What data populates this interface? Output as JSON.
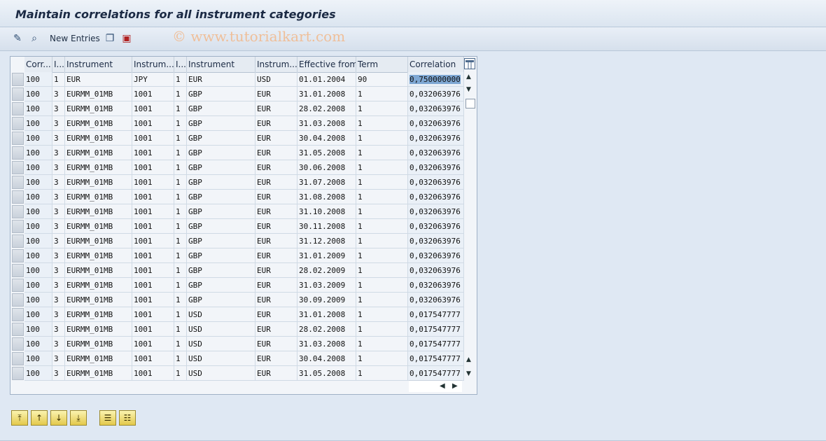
{
  "header": {
    "title": "Maintain correlations for all instrument categories"
  },
  "toolbar": {
    "new_entries_label": "New Entries",
    "icons": [
      "change-display-icon",
      "find-icon",
      "copy-icon",
      "delete-icon"
    ]
  },
  "watermark": "© www.tutorialkart.com",
  "table": {
    "columns": [
      "Corr...",
      "I...",
      "Instrument",
      "Instrum...",
      "I...",
      "Instrument",
      "Instrum...",
      "Effective from",
      "Term",
      "Correlation"
    ],
    "rows": [
      [
        "100",
        "1",
        "EUR",
        "JPY",
        "1",
        "EUR",
        "USD",
        "01.01.2004",
        "90",
        "0,750000000"
      ],
      [
        "100",
        "3",
        "EURMM_01MB",
        "1001",
        "1",
        "GBP",
        "EUR",
        "31.01.2008",
        "1",
        "0,032063976"
      ],
      [
        "100",
        "3",
        "EURMM_01MB",
        "1001",
        "1",
        "GBP",
        "EUR",
        "28.02.2008",
        "1",
        "0,032063976"
      ],
      [
        "100",
        "3",
        "EURMM_01MB",
        "1001",
        "1",
        "GBP",
        "EUR",
        "31.03.2008",
        "1",
        "0,032063976"
      ],
      [
        "100",
        "3",
        "EURMM_01MB",
        "1001",
        "1",
        "GBP",
        "EUR",
        "30.04.2008",
        "1",
        "0,032063976"
      ],
      [
        "100",
        "3",
        "EURMM_01MB",
        "1001",
        "1",
        "GBP",
        "EUR",
        "31.05.2008",
        "1",
        "0,032063976"
      ],
      [
        "100",
        "3",
        "EURMM_01MB",
        "1001",
        "1",
        "GBP",
        "EUR",
        "30.06.2008",
        "1",
        "0,032063976"
      ],
      [
        "100",
        "3",
        "EURMM_01MB",
        "1001",
        "1",
        "GBP",
        "EUR",
        "31.07.2008",
        "1",
        "0,032063976"
      ],
      [
        "100",
        "3",
        "EURMM_01MB",
        "1001",
        "1",
        "GBP",
        "EUR",
        "31.08.2008",
        "1",
        "0,032063976"
      ],
      [
        "100",
        "3",
        "EURMM_01MB",
        "1001",
        "1",
        "GBP",
        "EUR",
        "31.10.2008",
        "1",
        "0,032063976"
      ],
      [
        "100",
        "3",
        "EURMM_01MB",
        "1001",
        "1",
        "GBP",
        "EUR",
        "30.11.2008",
        "1",
        "0,032063976"
      ],
      [
        "100",
        "3",
        "EURMM_01MB",
        "1001",
        "1",
        "GBP",
        "EUR",
        "31.12.2008",
        "1",
        "0,032063976"
      ],
      [
        "100",
        "3",
        "EURMM_01MB",
        "1001",
        "1",
        "GBP",
        "EUR",
        "31.01.2009",
        "1",
        "0,032063976"
      ],
      [
        "100",
        "3",
        "EURMM_01MB",
        "1001",
        "1",
        "GBP",
        "EUR",
        "28.02.2009",
        "1",
        "0,032063976"
      ],
      [
        "100",
        "3",
        "EURMM_01MB",
        "1001",
        "1",
        "GBP",
        "EUR",
        "31.03.2009",
        "1",
        "0,032063976"
      ],
      [
        "100",
        "3",
        "EURMM_01MB",
        "1001",
        "1",
        "GBP",
        "EUR",
        "30.09.2009",
        "1",
        "0,032063976"
      ],
      [
        "100",
        "3",
        "EURMM_01MB",
        "1001",
        "1",
        "USD",
        "EUR",
        "31.01.2008",
        "1",
        "0,017547777"
      ],
      [
        "100",
        "3",
        "EURMM_01MB",
        "1001",
        "1",
        "USD",
        "EUR",
        "28.02.2008",
        "1",
        "0,017547777"
      ],
      [
        "100",
        "3",
        "EURMM_01MB",
        "1001",
        "1",
        "USD",
        "EUR",
        "31.03.2008",
        "1",
        "0,017547777"
      ],
      [
        "100",
        "3",
        "EURMM_01MB",
        "1001",
        "1",
        "USD",
        "EUR",
        "30.04.2008",
        "1",
        "0,017547777"
      ],
      [
        "100",
        "3",
        "EURMM_01MB",
        "1001",
        "1",
        "USD",
        "EUR",
        "31.05.2008",
        "1",
        "0,017547777"
      ]
    ]
  },
  "bottom_buttons": [
    "first-page-icon",
    "previous-page-icon",
    "next-page-icon",
    "last-page-icon",
    "select-all-icon",
    "deselect-all-icon"
  ],
  "colors": {
    "background": "#dfe8f3",
    "accent": "#7ea7d3",
    "button": "#e3c94c"
  }
}
